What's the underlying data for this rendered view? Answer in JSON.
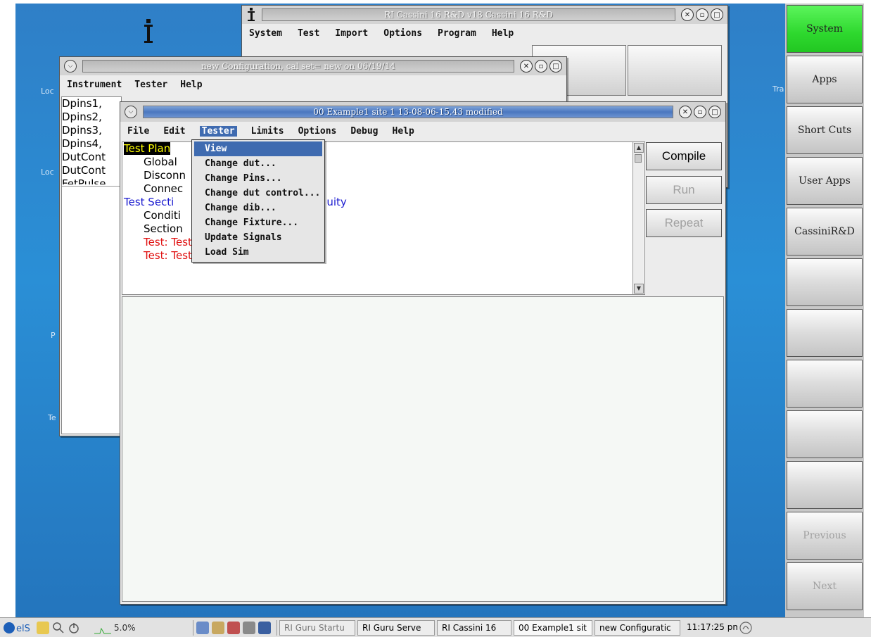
{
  "desktop": {
    "labels": [
      "Loc",
      "Loc",
      "P",
      "Te",
      "Tra"
    ]
  },
  "cassini_window": {
    "title": "RI Cassini 16 R&D v18  Cassini 16 R&D",
    "menu": [
      "System",
      "Test",
      "Import",
      "Options",
      "Program",
      "Help"
    ]
  },
  "config_window": {
    "title": "new Configuration,  cal set= new on 06/19/14",
    "menu": [
      "Instrument",
      "Tester",
      "Help"
    ],
    "items": [
      "Dpins1,",
      "Dpins2,",
      "Dpins3,",
      "Dpins4,",
      "DutCont",
      "DutCont",
      "FetPulse"
    ]
  },
  "example_window": {
    "title": "00 Example1  site 1 13-08-06-15.43  modified",
    "menu": [
      "File",
      "Edit",
      "Tester",
      "Limits",
      "Options",
      "Debug",
      "Help"
    ],
    "tree": [
      {
        "text": "Test Plan",
        "style": "selected"
      },
      {
        "text": "Global",
        "style": "normal"
      },
      {
        "text": "Disconn",
        "style": "normal"
      },
      {
        "text": "Connec",
        "style": "normal"
      },
      {
        "text": "Test Secti",
        "style": "blue"
      },
      {
        "text": "Conditi",
        "style": "normal"
      },
      {
        "text": "Section",
        "style": "normal"
      },
      {
        "text": "Test: Test Continuity PD_Neg",
        "style": "red"
      },
      {
        "text": "Test: Test Continuity PD_Pos",
        "style": "red"
      }
    ],
    "tree_suffix": "uity",
    "buttons": {
      "compile": "Compile",
      "run": "Run",
      "repeat": "Repeat"
    }
  },
  "tester_menu": {
    "items": [
      "View",
      "Change dut...",
      "Change Pins...",
      "Change dut control...",
      "Change dib...",
      "Change Fixture...",
      "Update Signals",
      "Load Sim"
    ],
    "selected_index": 0
  },
  "side_panel": {
    "buttons": [
      "System",
      "Apps",
      "Short Cuts",
      "User Apps",
      "CassiniR&D",
      "",
      "",
      "",
      "",
      "",
      "Previous",
      "Next"
    ],
    "active_color": "#33dd33"
  },
  "taskbar": {
    "cpu": "5.0%",
    "tasks": [
      "RI Guru Startu",
      "RI Guru Serve",
      "RI Cassini 16",
      "00 Example1 sit",
      "new Configuratic"
    ],
    "clock": "11:17:25 pm"
  }
}
